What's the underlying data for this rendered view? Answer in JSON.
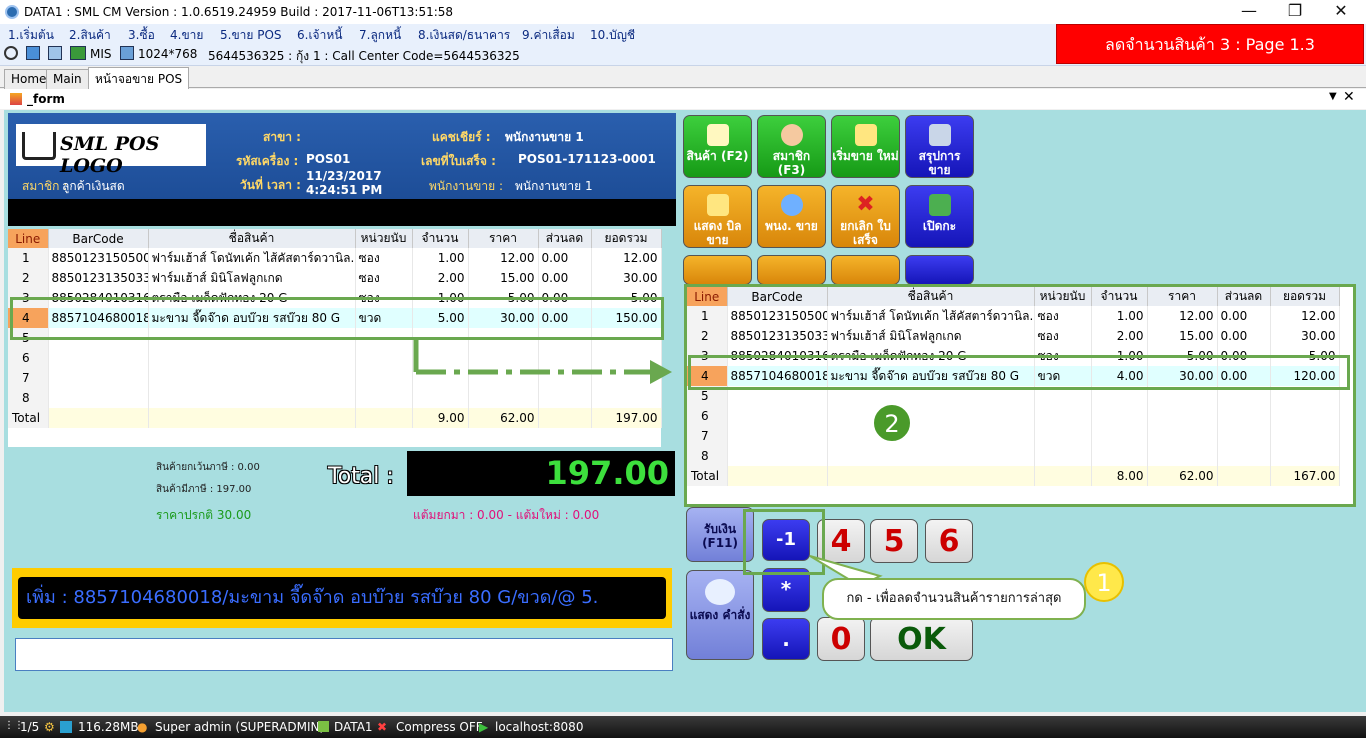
{
  "window": {
    "title": "DATA1 : SML CM Version : 1.0.6519.24959  Build : 2017-11-06T13:51:58"
  },
  "menu": [
    "1.เริ่มต้น",
    "2.สินค้า",
    "3.ซื้อ",
    "4.ขาย",
    "5.ขาย POS",
    "6.เจ้าหนี้",
    "7.ลูกหนี้",
    "8.เงินสด/ธนาคาร",
    "9.ค่าเสื่อม",
    "10.บัญชี"
  ],
  "toolbar": {
    "mis": "MIS",
    "resolution": "1024*768",
    "info": "5644536325 : กุ้ง 1 : Call Center Code=5644536325"
  },
  "banner": "ลดจำนวนสินค้า 3 : Page 1.3",
  "tabs": [
    "Home",
    "Main",
    "หน้าจอขาย POS"
  ],
  "form_title": "_form",
  "header": {
    "logo": "SML POS LOGO",
    "branch_label": "สาขา :",
    "machine_label": "รหัสเครื่อง :",
    "machine": "POS01",
    "datetime_label": "วันที่ เวลา :",
    "date": "11/23/2017",
    "time": "4:24:51 PM",
    "member_label": "สมาชิก :",
    "member": "ลูกค้าเงินสด",
    "cashier_label": "แคชเชียร์ :",
    "cashier": "พนักงานขาย 1",
    "receipt_label": "เลขที่ใบเสร็จ :",
    "receipt": "POS01-171123-0001",
    "seller_label": "พนักงานขาย :",
    "seller": "พนักงานขาย 1"
  },
  "columns": [
    "Line",
    "BarCode",
    "ชื่อสินค้า",
    "หน่วยนับ",
    "จำนวน",
    "ราคา",
    "ส่วนลด",
    "ยอดรวม"
  ],
  "rows": [
    {
      "line": "1",
      "barcode": "8850123150500",
      "name": "ฟาร์มเฮ้าส์  โดนัทเค้ก ไส้คัสตาร์ดวานิล..",
      "unit": "ซอง",
      "qty": "1.00",
      "price": "12.00",
      "disc": "0.00",
      "total": "12.00"
    },
    {
      "line": "2",
      "barcode": "8850123135033",
      "name": "ฟาร์มเฮ้าส์  มินิโลฟลูกเกด",
      "unit": "ซอง",
      "qty": "2.00",
      "price": "15.00",
      "disc": "0.00",
      "total": "30.00"
    },
    {
      "line": "3",
      "barcode": "8850284010316",
      "name": "ตรามือ  เมล็ดฟักทอง  20  G",
      "unit": "ซอง",
      "qty": "1.00",
      "price": "5.00",
      "disc": "0.00",
      "total": "5.00"
    },
    {
      "line": "4",
      "barcode": "8857104680018",
      "name": "มะขาม  จี๊ดจ๊าด  อบบ๊วย  รสบ๊วย  80  G",
      "unit": "ขวด",
      "qty": "5.00",
      "price": "30.00",
      "disc": "0.00",
      "total": "150.00"
    }
  ],
  "empty_lines": [
    "5",
    "6",
    "7",
    "8"
  ],
  "totals": {
    "label": "Total",
    "qty": "9.00",
    "price": "62.00",
    "total": "197.00"
  },
  "popup_rows": [
    {
      "line": "1",
      "barcode": "8850123150500",
      "name": "ฟาร์มเฮ้าส์  โดนัทเค้ก ไส้คัสตาร์ดวานิล..",
      "unit": "ซอง",
      "qty": "1.00",
      "price": "12.00",
      "disc": "0.00",
      "total": "12.00"
    },
    {
      "line": "2",
      "barcode": "8850123135033",
      "name": "ฟาร์มเฮ้าส์  มินิโลฟลูกเกด",
      "unit": "ซอง",
      "qty": "2.00",
      "price": "15.00",
      "disc": "0.00",
      "total": "30.00"
    },
    {
      "line": "3",
      "barcode": "8850284010316",
      "name": "ตรามือ  เมล็ดฟักทอง  20  G",
      "unit": "ซอง",
      "qty": "1.00",
      "price": "5.00",
      "disc": "0.00",
      "total": "5.00"
    },
    {
      "line": "4",
      "barcode": "8857104680018",
      "name": "มะขาม  จี๊ดจ๊าด  อบบ๊วย  รสบ๊วย  80  G",
      "unit": "ขวด",
      "qty": "4.00",
      "price": "30.00",
      "disc": "0.00",
      "total": "120.00"
    }
  ],
  "popup_totals": {
    "label": "Total",
    "qty": "8.00",
    "price": "62.00",
    "total": "167.00"
  },
  "summary": {
    "non_vat": "สินค้ายกเว้นภาษี : 0.00",
    "vat": "สินค้ามีภาษี : 197.00",
    "normal_price": "ราคาปรกติ 30.00",
    "total_label": "Total :",
    "total_value": "197.00",
    "points": "แต้มยกมา : 0.00 - แต้มใหม่ : 0.00"
  },
  "marquee": "เพิ่ม : 8857104680018/มะขาม จี๊ดจ๊าด อบบ๊วย รสบ๊วย 80 G/ขวด/@ 5.",
  "buttons": {
    "product": "สินค้า (F2)",
    "member": "สมาชิก (F3)",
    "new_sale": "เริ่มขาย ใหม่",
    "summary": "สรุปการ ขาย",
    "show_bill": "แสดง บิลขาย",
    "salesperson": "พนง. ขาย",
    "cancel_receipt": "ยกเลิก ใบเสร็จ",
    "open_drawer": "เปิดกะ",
    "pay": "รับเงิน (F11)",
    "show_cmd": "แสดง คำสั่ง",
    "minus1": "-1",
    "star": "*",
    "dot": ".",
    "d4": "4",
    "d5": "5",
    "d6": "6",
    "d0": "0",
    "ok": "OK"
  },
  "annotation": {
    "one": "1",
    "two": "2",
    "callout": "กด - เพื่อลดจำนวนสินค้ารายการล่าสุด"
  },
  "status": {
    "page": "1/5",
    "memory": "116.28MB",
    "user": "Super admin (SUPERADMIN)",
    "db": "DATA1",
    "compress": "Compress OFF",
    "server": "localhost:8080"
  }
}
